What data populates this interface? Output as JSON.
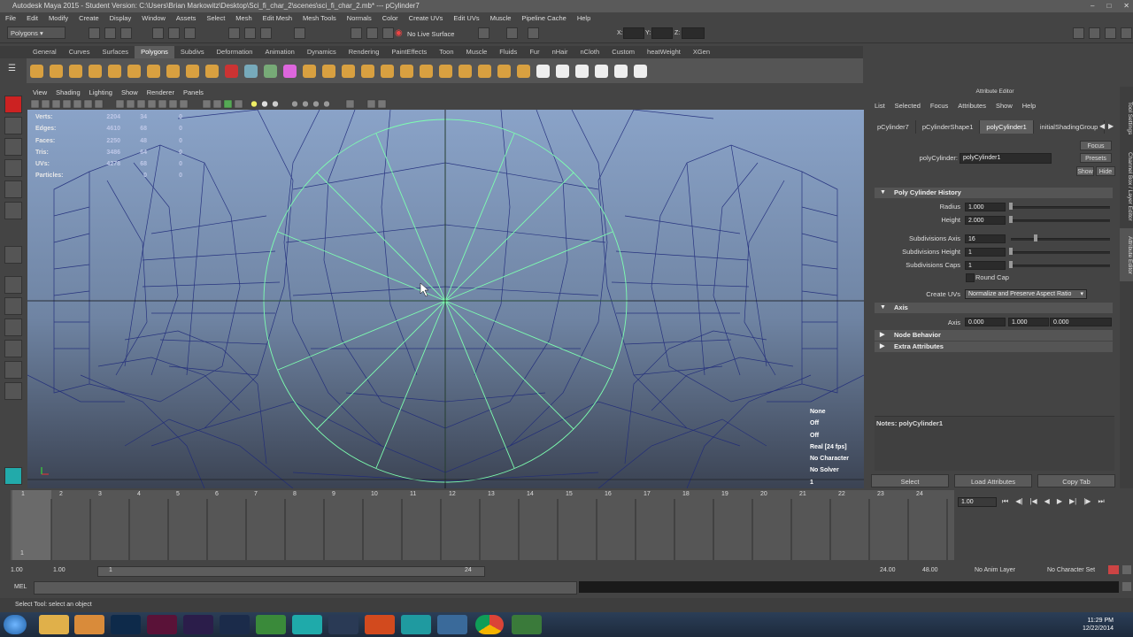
{
  "window": {
    "title": "Autodesk Maya 2015 - Student Version: C:\\Users\\Brian Markowitz\\Desktop\\Sci_fi_char_2\\scenes\\sci_fi_char_2.mb* --- pCylinder7"
  },
  "menubar": [
    "File",
    "Edit",
    "Modify",
    "Create",
    "Display",
    "Window",
    "Assets",
    "Select",
    "Mesh",
    "Edit Mesh",
    "Mesh Tools",
    "Normals",
    "Color",
    "Create UVs",
    "Edit UVs",
    "Muscle",
    "Pipeline Cache",
    "Help"
  ],
  "statusline": {
    "mode": "Polygons",
    "live_surface": "No Live Surface",
    "x_label": "X:",
    "y_label": "Y:",
    "z_label": "Z:"
  },
  "shelf_tabs": [
    "General",
    "Curves",
    "Surfaces",
    "Polygons",
    "Subdivs",
    "Deformation",
    "Animation",
    "Dynamics",
    "Rendering",
    "PaintEffects",
    "Toon",
    "Muscle",
    "Fluids",
    "Fur",
    "nHair",
    "nCloth",
    "Custom",
    "heatWeight",
    "XGen"
  ],
  "shelf_active": "Polygons",
  "viewport": {
    "menu": [
      "View",
      "Shading",
      "Lighting",
      "Show",
      "Renderer",
      "Panels"
    ],
    "hud_stats": [
      {
        "label": "Verts:",
        "v1": "2204",
        "v2": "34",
        "v3": "0"
      },
      {
        "label": "Edges:",
        "v1": "4610",
        "v2": "68",
        "v3": "0"
      },
      {
        "label": "Faces:",
        "v1": "2250",
        "v2": "48",
        "v3": "0"
      },
      {
        "label": "Tris:",
        "v1": "3486",
        "v2": "64",
        "v3": "0"
      },
      {
        "label": "UVs:",
        "v1": "4278",
        "v2": "68",
        "v3": "0"
      },
      {
        "label": "Particles:",
        "v1": "",
        "v2": "0",
        "v3": "0"
      }
    ],
    "hud_right": [
      "None",
      "Off",
      "Off",
      "Real [24 fps]",
      "No Character",
      "No Solver",
      "1"
    ]
  },
  "attribute_editor": {
    "title": "Attribute Editor",
    "menu": [
      "List",
      "Selected",
      "Focus",
      "Attributes",
      "Show",
      "Help"
    ],
    "tabs": [
      "pCylinder7",
      "pCylinderShape1",
      "polyCylinder1",
      "initialShadingGroup"
    ],
    "active_tab": "polyCylinder1",
    "focus_btn": "Focus",
    "presets_btn": "Presets",
    "show_btn": "Show",
    "hide_btn": "Hide",
    "node_label": "polyCylinder:",
    "node_value": "polyCylinder1",
    "section_history": "Poly Cylinder History",
    "radius_label": "Radius",
    "radius_value": "1.000",
    "height_label": "Height",
    "height_value": "2.000",
    "subdiv_axis_label": "Subdivisions Axis",
    "subdiv_axis_value": "16",
    "subdiv_height_label": "Subdivisions Height",
    "subdiv_height_value": "1",
    "subdiv_caps_label": "Subdivisions Caps",
    "subdiv_caps_value": "1",
    "round_cap_label": "Round Cap",
    "create_uvs_label": "Create UVs",
    "create_uvs_value": "Normalize and Preserve Aspect Ratio",
    "section_axis": "Axis",
    "axis_label": "Axis",
    "axis_x": "0.000",
    "axis_y": "1.000",
    "axis_z": "0.000",
    "section_node_behavior": "Node Behavior",
    "section_extra": "Extra Attributes",
    "notes": "Notes: polyCylinder1",
    "select_btn": "Select",
    "load_btn": "Load Attributes",
    "copy_btn": "Copy Tab"
  },
  "side_tabs": [
    "Tool Settings",
    "Channel Box / Layer Editor",
    "Attribute Editor"
  ],
  "timeline": {
    "ticks": [
      "1",
      "2",
      "3",
      "4",
      "5",
      "6",
      "7",
      "8",
      "9",
      "10",
      "11",
      "12",
      "13",
      "14",
      "15",
      "16",
      "17",
      "18",
      "19",
      "20",
      "21",
      "22",
      "23",
      "24"
    ],
    "current_frame": "1.00",
    "current_marker": "1"
  },
  "range": {
    "start": "1.00",
    "start2": "1.00",
    "slider_start": "1",
    "slider_end": "24",
    "end": "24.00",
    "end2": "48.00",
    "anim_layer": "No Anim Layer",
    "character_set": "No Character Set"
  },
  "mel_label": "MEL",
  "help_line": "Select Tool: select an object",
  "clock": {
    "time": "11:29 PM",
    "date": "12/22/2014"
  },
  "colors": {
    "wire": "#1a237e",
    "selected_wire": "#7dffb0",
    "accent": "#5d5d5d"
  }
}
